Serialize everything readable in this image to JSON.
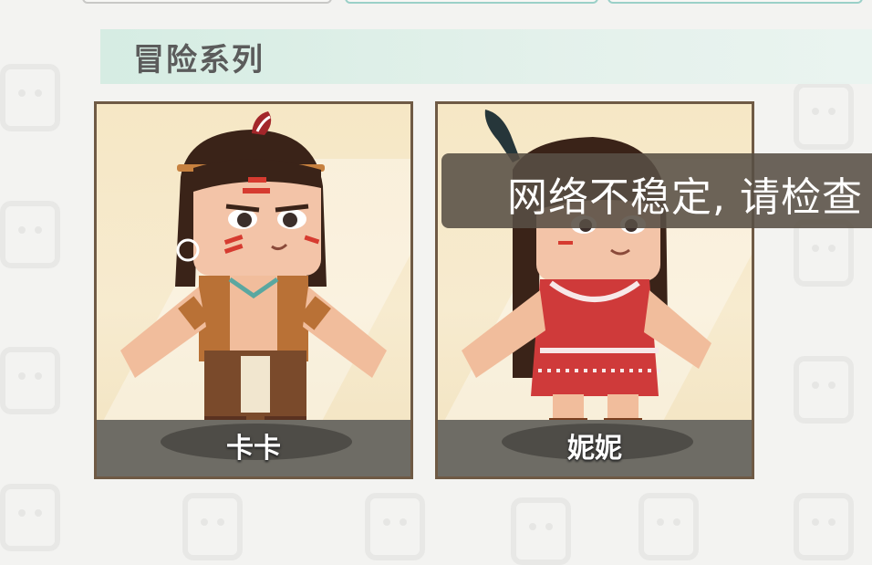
{
  "section": {
    "title": "冒险系列"
  },
  "characters": [
    {
      "name": "卡卡",
      "icon": "kaka-avatar-icon"
    },
    {
      "name": "妮妮",
      "icon": "nini-avatar-icon"
    }
  ],
  "toast": {
    "message": "网络不稳定, 请检查"
  },
  "colors": {
    "card_border": "#6f5a45",
    "header_bg": "#d4ece2",
    "name_bar": "#6e6c65"
  }
}
